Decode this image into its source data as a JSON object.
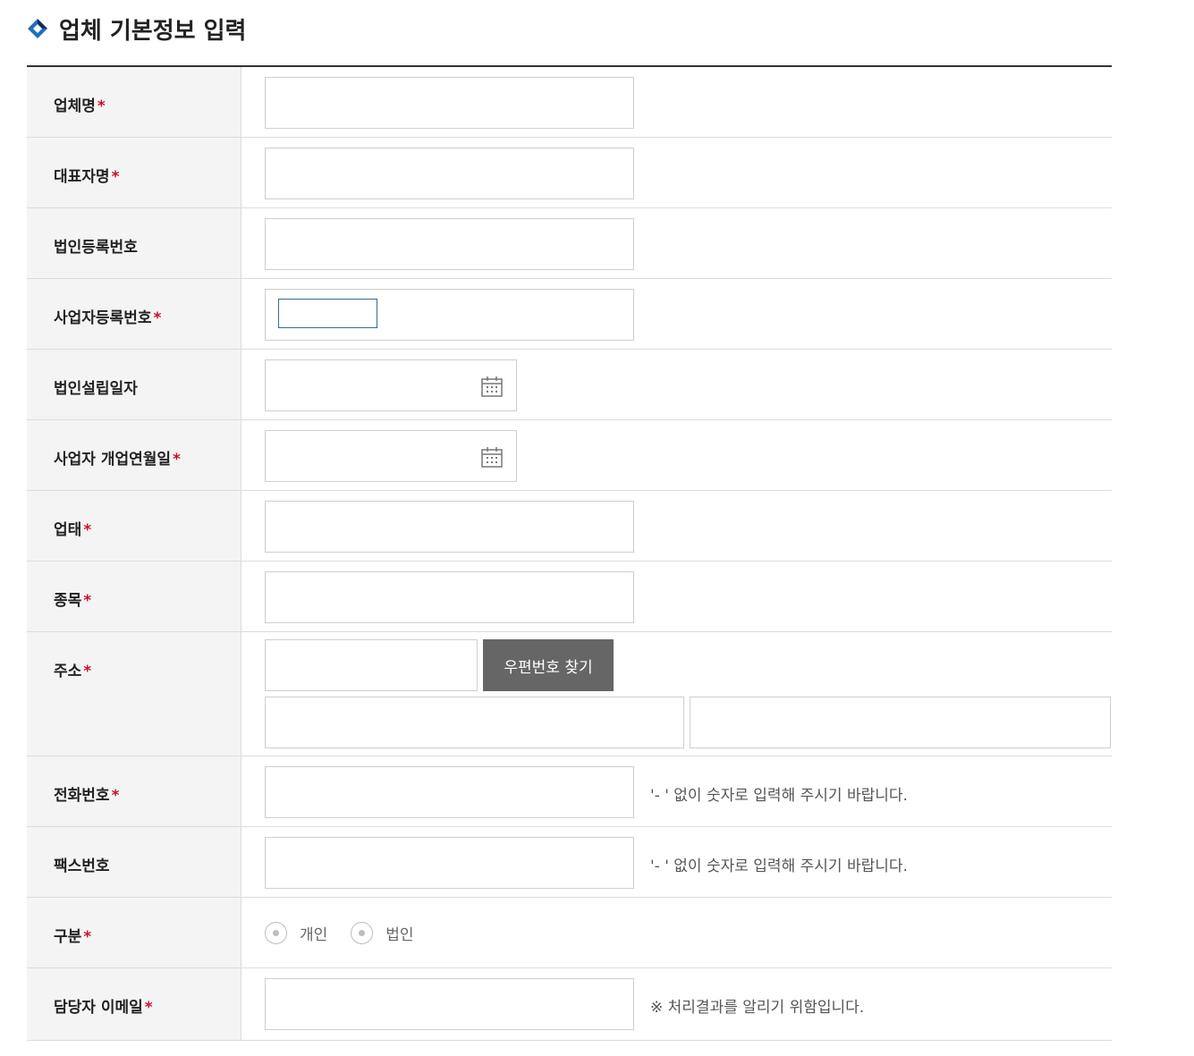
{
  "page": {
    "title": "업체 기본정보 입력"
  },
  "fields": {
    "company_name": {
      "label": "업체명",
      "required": "*"
    },
    "ceo_name": {
      "label": "대표자명",
      "required": "*"
    },
    "corp_reg_no": {
      "label": "법인등록번호"
    },
    "biz_reg_no": {
      "label": "사업자등록번호",
      "required": "*"
    },
    "corp_est_date": {
      "label": "법인설립일자"
    },
    "biz_open_date": {
      "label": "사업자 개업연월일",
      "required": "*"
    },
    "business_type": {
      "label": "업태",
      "required": "*"
    },
    "business_item": {
      "label": "종목",
      "required": "*"
    },
    "address": {
      "label": "주소",
      "required": "*",
      "zip_button": "우편번호 찾기"
    },
    "phone": {
      "label": "전화번호",
      "required": "*",
      "hint": "'- ' 없이 숫자로 입력해 주시기 바랍니다."
    },
    "fax": {
      "label": "팩스번호",
      "hint": "'- ' 없이 숫자로 입력해 주시기 바랍니다."
    },
    "division": {
      "label": "구분",
      "required": "*",
      "options": [
        "개인",
        "법인"
      ]
    },
    "manager_email": {
      "label": "담당자 이메일",
      "required": "*",
      "hint": "※ 처리결과를 알리기 위함입니다."
    }
  },
  "icons": {
    "title": "diamond-bullet-icon",
    "calendar": "calendar-icon"
  },
  "colors": {
    "accent": "#1f6fbf",
    "required": "#c8102e",
    "button": "#666666"
  }
}
